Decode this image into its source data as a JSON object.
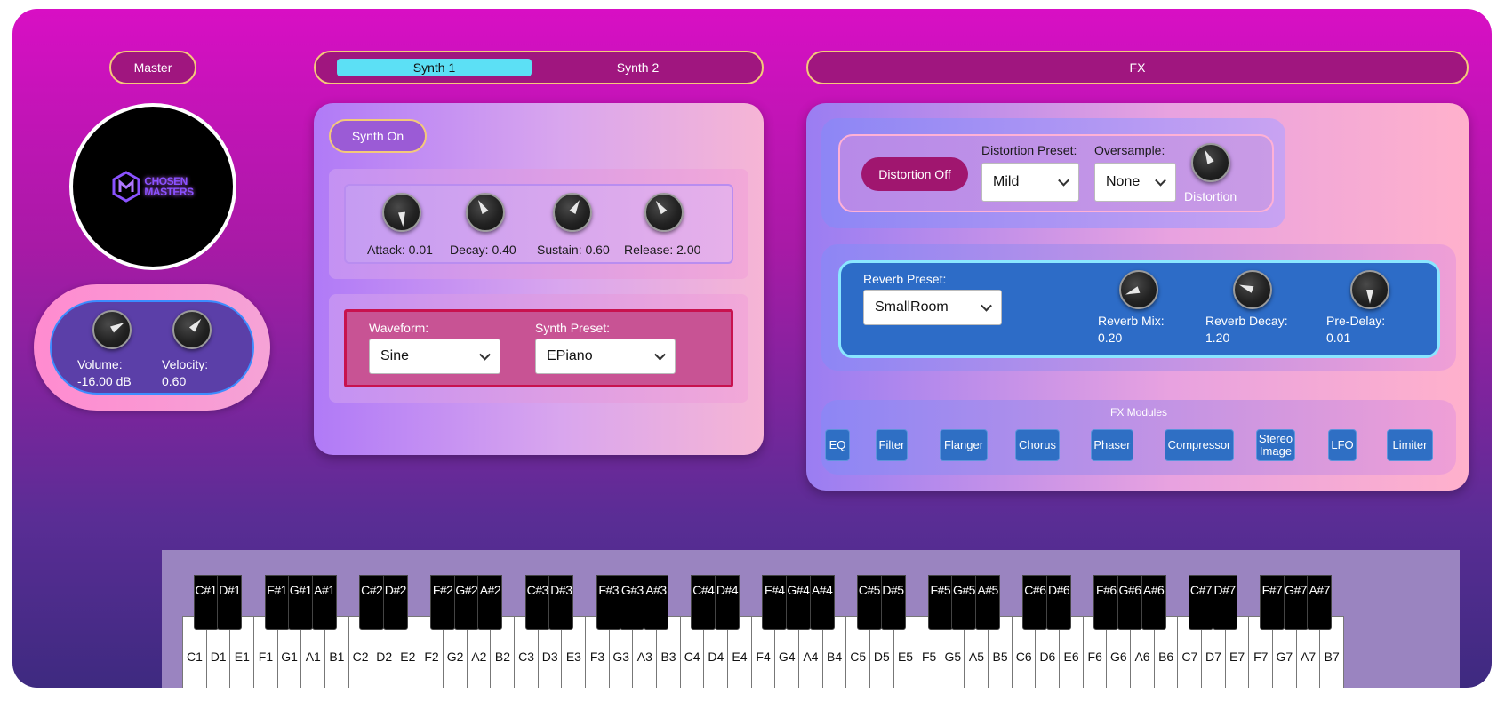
{
  "master": {
    "tab_label": "Master"
  },
  "logo": {
    "line1": "CHOSEN",
    "line2": "MASTERS"
  },
  "master_controls": {
    "volume_label": "Volume:",
    "volume_value": "-16.00 dB",
    "velocity_label": "Velocity:",
    "velocity_value": "0.60"
  },
  "synth_tabs": [
    {
      "label": "Synth 1",
      "active": true
    },
    {
      "label": "Synth 2",
      "active": false
    }
  ],
  "synth": {
    "power_button": "Synth On",
    "envelope": [
      {
        "label": "Attack: 0.01",
        "value": 0.01,
        "icon": "knob-icon"
      },
      {
        "label": "Decay: 0.40",
        "value": 0.4,
        "icon": "knob-icon"
      },
      {
        "label": "Sustain: 0.60",
        "value": 0.6,
        "icon": "knob-icon"
      },
      {
        "label": "Release: 2.00",
        "value": 2.0,
        "icon": "knob-icon"
      }
    ],
    "waveform_label": "Waveform:",
    "waveform_value": "Sine",
    "preset_label": "Synth Preset:",
    "preset_value": "EPiano"
  },
  "fx": {
    "tab_label": "FX",
    "distortion": {
      "button": "Distortion Off",
      "preset_label": "Distortion Preset:",
      "preset_value": "Mild",
      "oversample_label": "Oversample:",
      "oversample_value": "None",
      "knob_label": "Distortion"
    },
    "reverb": {
      "preset_label": "Reverb Preset:",
      "preset_value": "SmallRoom",
      "mix_label": "Reverb Mix:",
      "mix_value": "0.20",
      "decay_label": "Reverb Decay:",
      "decay_value": "1.20",
      "predelay_label": "Pre-Delay:",
      "predelay_value": "0.01"
    },
    "modules_title": "FX Modules",
    "modules": [
      "EQ",
      "Filter",
      "Flanger",
      "Chorus",
      "Phaser",
      "Compressor",
      "Stereo Image",
      "LFO",
      "Limiter"
    ]
  },
  "keyboard": {
    "white_keys": [
      "C1",
      "D1",
      "E1",
      "F1",
      "G1",
      "A1",
      "B1",
      "C2",
      "D2",
      "E2",
      "F2",
      "G2",
      "A2",
      "B2",
      "C3",
      "D3",
      "E3",
      "F3",
      "G3",
      "A3",
      "B3",
      "C4",
      "D4",
      "E4",
      "F4",
      "G4",
      "A4",
      "B4",
      "C5",
      "D5",
      "E5",
      "F5",
      "G5",
      "A5",
      "B5",
      "C6",
      "D6",
      "E6",
      "F6",
      "G6",
      "A6",
      "B6",
      "C7",
      "D7",
      "E7",
      "F7",
      "G7",
      "A7",
      "B7"
    ],
    "black_keys": [
      "C#1",
      "D#1",
      "F#1",
      "G#1",
      "A#1",
      "C#2",
      "D#2",
      "F#2",
      "G#2",
      "A#2",
      "C#3",
      "D#3",
      "F#3",
      "G#3",
      "A#3",
      "C#4",
      "D#4",
      "F#4",
      "G#4",
      "A#4",
      "C#5",
      "D#5",
      "F#5",
      "G#5",
      "A#5",
      "C#6",
      "D#6",
      "F#6",
      "G#6",
      "A#6",
      "C#7",
      "D#7",
      "F#7",
      "G#7",
      "A#7"
    ]
  },
  "colors": {
    "accent_cyan": "#5ce0f5",
    "tab_border": "#f4c97a",
    "fx_button": "#2f6fc4",
    "reverb_panel": "#2d6cc7",
    "distortion_button": "#a0166f",
    "waveform_border": "#c8124f"
  }
}
